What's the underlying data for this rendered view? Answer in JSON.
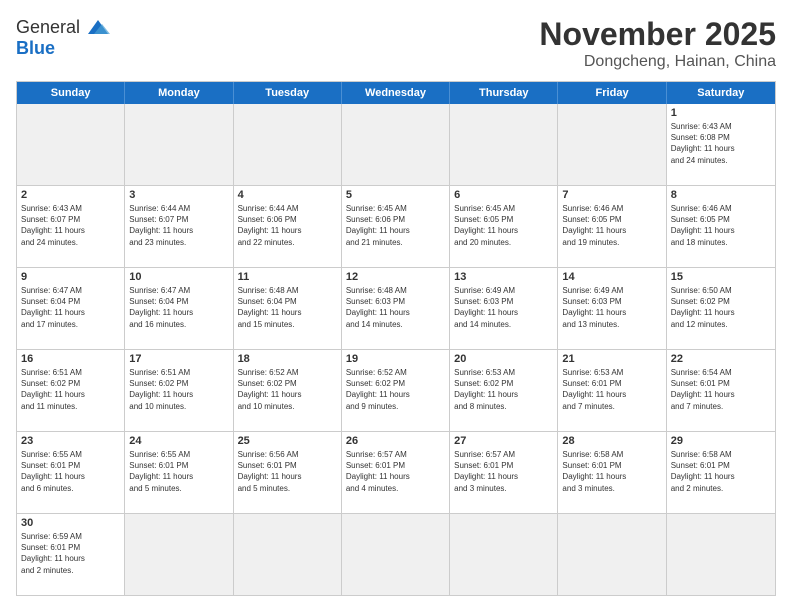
{
  "header": {
    "logo_general": "General",
    "logo_blue": "Blue",
    "month_title": "November 2025",
    "location": "Dongcheng, Hainan, China"
  },
  "calendar": {
    "days": [
      "Sunday",
      "Monday",
      "Tuesday",
      "Wednesday",
      "Thursday",
      "Friday",
      "Saturday"
    ],
    "rows": [
      [
        {
          "day": "",
          "empty": true
        },
        {
          "day": "",
          "empty": true
        },
        {
          "day": "",
          "empty": true
        },
        {
          "day": "",
          "empty": true
        },
        {
          "day": "",
          "empty": true
        },
        {
          "day": "",
          "empty": true
        },
        {
          "day": "1",
          "info": "Sunrise: 6:43 AM\nSunset: 6:08 PM\nDaylight: 11 hours\nand 24 minutes."
        }
      ],
      [
        {
          "day": "2",
          "info": "Sunrise: 6:43 AM\nSunset: 6:07 PM\nDaylight: 11 hours\nand 24 minutes."
        },
        {
          "day": "3",
          "info": "Sunrise: 6:44 AM\nSunset: 6:07 PM\nDaylight: 11 hours\nand 23 minutes."
        },
        {
          "day": "4",
          "info": "Sunrise: 6:44 AM\nSunset: 6:06 PM\nDaylight: 11 hours\nand 22 minutes."
        },
        {
          "day": "5",
          "info": "Sunrise: 6:45 AM\nSunset: 6:06 PM\nDaylight: 11 hours\nand 21 minutes."
        },
        {
          "day": "6",
          "info": "Sunrise: 6:45 AM\nSunset: 6:05 PM\nDaylight: 11 hours\nand 20 minutes."
        },
        {
          "day": "7",
          "info": "Sunrise: 6:46 AM\nSunset: 6:05 PM\nDaylight: 11 hours\nand 19 minutes."
        },
        {
          "day": "8",
          "info": "Sunrise: 6:46 AM\nSunset: 6:05 PM\nDaylight: 11 hours\nand 18 minutes."
        }
      ],
      [
        {
          "day": "9",
          "info": "Sunrise: 6:47 AM\nSunset: 6:04 PM\nDaylight: 11 hours\nand 17 minutes."
        },
        {
          "day": "10",
          "info": "Sunrise: 6:47 AM\nSunset: 6:04 PM\nDaylight: 11 hours\nand 16 minutes."
        },
        {
          "day": "11",
          "info": "Sunrise: 6:48 AM\nSunset: 6:04 PM\nDaylight: 11 hours\nand 15 minutes."
        },
        {
          "day": "12",
          "info": "Sunrise: 6:48 AM\nSunset: 6:03 PM\nDaylight: 11 hours\nand 14 minutes."
        },
        {
          "day": "13",
          "info": "Sunrise: 6:49 AM\nSunset: 6:03 PM\nDaylight: 11 hours\nand 14 minutes."
        },
        {
          "day": "14",
          "info": "Sunrise: 6:49 AM\nSunset: 6:03 PM\nDaylight: 11 hours\nand 13 minutes."
        },
        {
          "day": "15",
          "info": "Sunrise: 6:50 AM\nSunset: 6:02 PM\nDaylight: 11 hours\nand 12 minutes."
        }
      ],
      [
        {
          "day": "16",
          "info": "Sunrise: 6:51 AM\nSunset: 6:02 PM\nDaylight: 11 hours\nand 11 minutes."
        },
        {
          "day": "17",
          "info": "Sunrise: 6:51 AM\nSunset: 6:02 PM\nDaylight: 11 hours\nand 10 minutes."
        },
        {
          "day": "18",
          "info": "Sunrise: 6:52 AM\nSunset: 6:02 PM\nDaylight: 11 hours\nand 10 minutes."
        },
        {
          "day": "19",
          "info": "Sunrise: 6:52 AM\nSunset: 6:02 PM\nDaylight: 11 hours\nand 9 minutes."
        },
        {
          "day": "20",
          "info": "Sunrise: 6:53 AM\nSunset: 6:02 PM\nDaylight: 11 hours\nand 8 minutes."
        },
        {
          "day": "21",
          "info": "Sunrise: 6:53 AM\nSunset: 6:01 PM\nDaylight: 11 hours\nand 7 minutes."
        },
        {
          "day": "22",
          "info": "Sunrise: 6:54 AM\nSunset: 6:01 PM\nDaylight: 11 hours\nand 7 minutes."
        }
      ],
      [
        {
          "day": "23",
          "info": "Sunrise: 6:55 AM\nSunset: 6:01 PM\nDaylight: 11 hours\nand 6 minutes."
        },
        {
          "day": "24",
          "info": "Sunrise: 6:55 AM\nSunset: 6:01 PM\nDaylight: 11 hours\nand 5 minutes."
        },
        {
          "day": "25",
          "info": "Sunrise: 6:56 AM\nSunset: 6:01 PM\nDaylight: 11 hours\nand 5 minutes."
        },
        {
          "day": "26",
          "info": "Sunrise: 6:57 AM\nSunset: 6:01 PM\nDaylight: 11 hours\nand 4 minutes."
        },
        {
          "day": "27",
          "info": "Sunrise: 6:57 AM\nSunset: 6:01 PM\nDaylight: 11 hours\nand 3 minutes."
        },
        {
          "day": "28",
          "info": "Sunrise: 6:58 AM\nSunset: 6:01 PM\nDaylight: 11 hours\nand 3 minutes."
        },
        {
          "day": "29",
          "info": "Sunrise: 6:58 AM\nSunset: 6:01 PM\nDaylight: 11 hours\nand 2 minutes."
        }
      ],
      [
        {
          "day": "30",
          "info": "Sunrise: 6:59 AM\nSunset: 6:01 PM\nDaylight: 11 hours\nand 2 minutes."
        },
        {
          "day": "",
          "empty": true
        },
        {
          "day": "",
          "empty": true
        },
        {
          "day": "",
          "empty": true
        },
        {
          "day": "",
          "empty": true
        },
        {
          "day": "",
          "empty": true
        },
        {
          "day": "",
          "empty": true
        }
      ]
    ]
  }
}
